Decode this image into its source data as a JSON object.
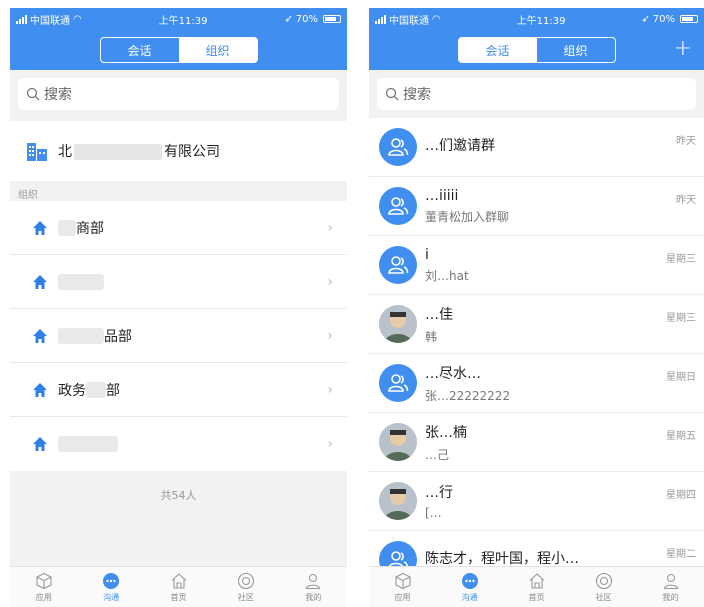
{
  "status": {
    "carrier": "中国联通",
    "time": "上午11:39",
    "battery": "70%"
  },
  "left": {
    "tabs": [
      "会话",
      "组织"
    ],
    "search_placeholder": "搜索",
    "company": {
      "prefix": "北",
      "suffix": "有限公司"
    },
    "section_label": "组织",
    "org_rows": [
      {
        "pre": "",
        "post": "商部"
      },
      {
        "pre": "",
        "post": ""
      },
      {
        "pre": "",
        "post": "品部"
      },
      {
        "pre": "政务",
        "post": "部"
      },
      {
        "pre": "",
        "post": ""
      }
    ],
    "total": "共54人"
  },
  "right": {
    "tabs": [
      "会话",
      "组织"
    ],
    "plus": "+",
    "search_placeholder": "搜索",
    "chats": [
      {
        "kind": "group",
        "title": "…们邀请群",
        "preview": "",
        "time": "昨天"
      },
      {
        "kind": "group",
        "title": "…iiiii",
        "preview": "董青松加入群聊",
        "time": "昨天"
      },
      {
        "kind": "group",
        "title": "i",
        "preview": "刘…hat",
        "time": "星期三"
      },
      {
        "kind": "photo",
        "title": "…佳",
        "preview": "韩",
        "time": "星期三"
      },
      {
        "kind": "group",
        "title": "…尽水…",
        "preview": "张…22222222",
        "time": "星期日"
      },
      {
        "kind": "photo",
        "title": "张…楠",
        "preview": "…己",
        "time": "星期五"
      },
      {
        "kind": "photo",
        "title": "…行",
        "preview": "[…",
        "time": "星期四"
      },
      {
        "kind": "group",
        "title": "陈志才，程叶国，程小…",
        "preview": "",
        "time": "星期二"
      }
    ]
  },
  "tabbar": [
    {
      "label": "应用",
      "icon": "cube-icon"
    },
    {
      "label": "沟通",
      "icon": "chat-bubble-icon",
      "active": true
    },
    {
      "label": "首页",
      "icon": "home-icon"
    },
    {
      "label": "社区",
      "icon": "community-icon"
    },
    {
      "label": "我的",
      "icon": "user-icon"
    }
  ],
  "colors": {
    "accent": "#3f8ef0",
    "background": "#f2f2f2"
  }
}
